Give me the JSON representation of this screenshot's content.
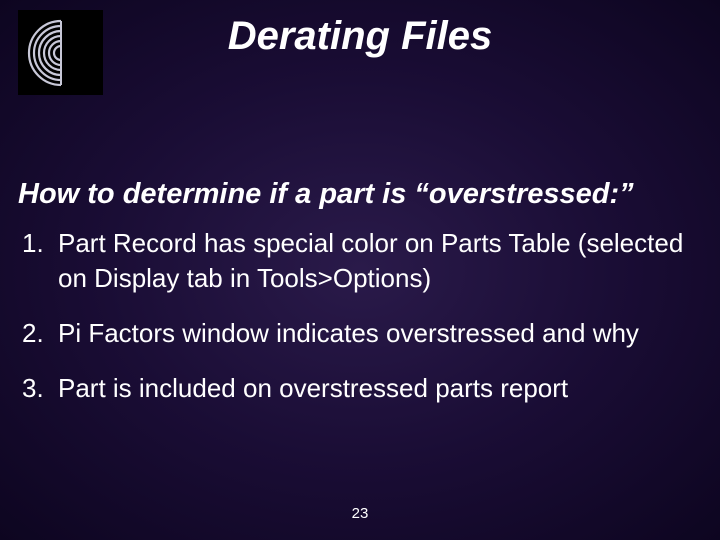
{
  "title": "Derating Files",
  "subtitle": "How to determine if a part is “overstressed:”",
  "items": [
    {
      "num": "1.",
      "text": "Part Record has special color on Parts Table (selected on Display tab in Tools>Options)"
    },
    {
      "num": "2.",
      "text": "Pi Factors window indicates overstressed and why"
    },
    {
      "num": "3.",
      "text": "Part is included on overstressed parts report"
    }
  ],
  "page_number": "23"
}
